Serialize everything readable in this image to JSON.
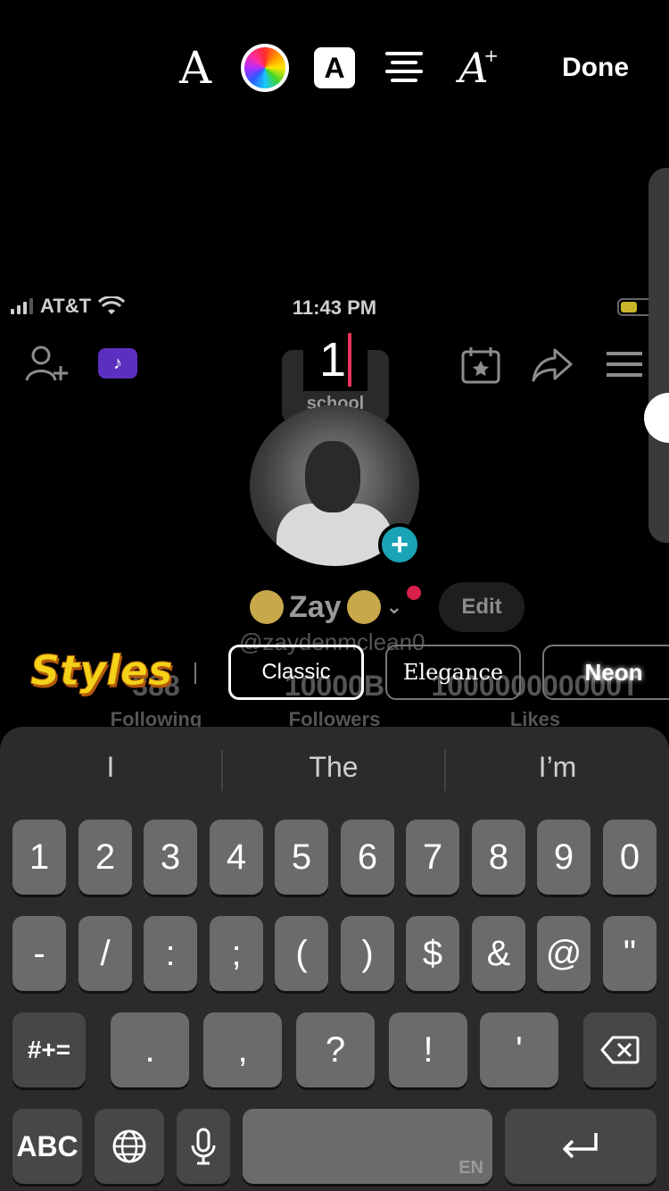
{
  "toolbar": {
    "font_icon_glyph": "A",
    "text_bg_icon_glyph": "A",
    "effects_icon_glyph": "A",
    "effects_icon_spark": "+",
    "done_label": "Done",
    "icons": [
      "font-style-icon",
      "color-wheel-icon",
      "text-background-icon",
      "align-center-icon",
      "text-effects-icon"
    ]
  },
  "typed_text": "1",
  "background_screenshot": {
    "status": {
      "carrier": "AT&T",
      "time": "11:43 PM"
    },
    "badge_glyph": "♪",
    "school_card_label": "school",
    "avatar_plus": "+",
    "display_name": "Zay",
    "edit_label": "Edit",
    "handle": "@zaydenmclean0",
    "stats": [
      {
        "value": "388",
        "label": "Following"
      },
      {
        "value": "10000B",
        "label": "Followers"
      },
      {
        "value": "100000000000T",
        "label": "Likes"
      }
    ]
  },
  "styles": {
    "title": "Styles",
    "options": [
      "Classic",
      "Elegance",
      "Neon"
    ],
    "selected": "Classic"
  },
  "keyboard": {
    "suggestions": [
      "I",
      "The",
      "I’m"
    ],
    "row1": [
      "1",
      "2",
      "3",
      "4",
      "5",
      "6",
      "7",
      "8",
      "9",
      "0"
    ],
    "row2": [
      "-",
      "/",
      ":",
      ";",
      "(",
      ")",
      "$",
      "&",
      "@",
      "\""
    ],
    "row3_left": "#+=",
    "row3": [
      ".",
      ",",
      "?",
      "!",
      "'"
    ],
    "bottom": {
      "abc": "ABC",
      "space_lang": "EN"
    }
  },
  "colors": {
    "accent_caret": "#e8335b",
    "styles_title": "#f5d21a",
    "plus_badge": "#1aa3b5"
  }
}
